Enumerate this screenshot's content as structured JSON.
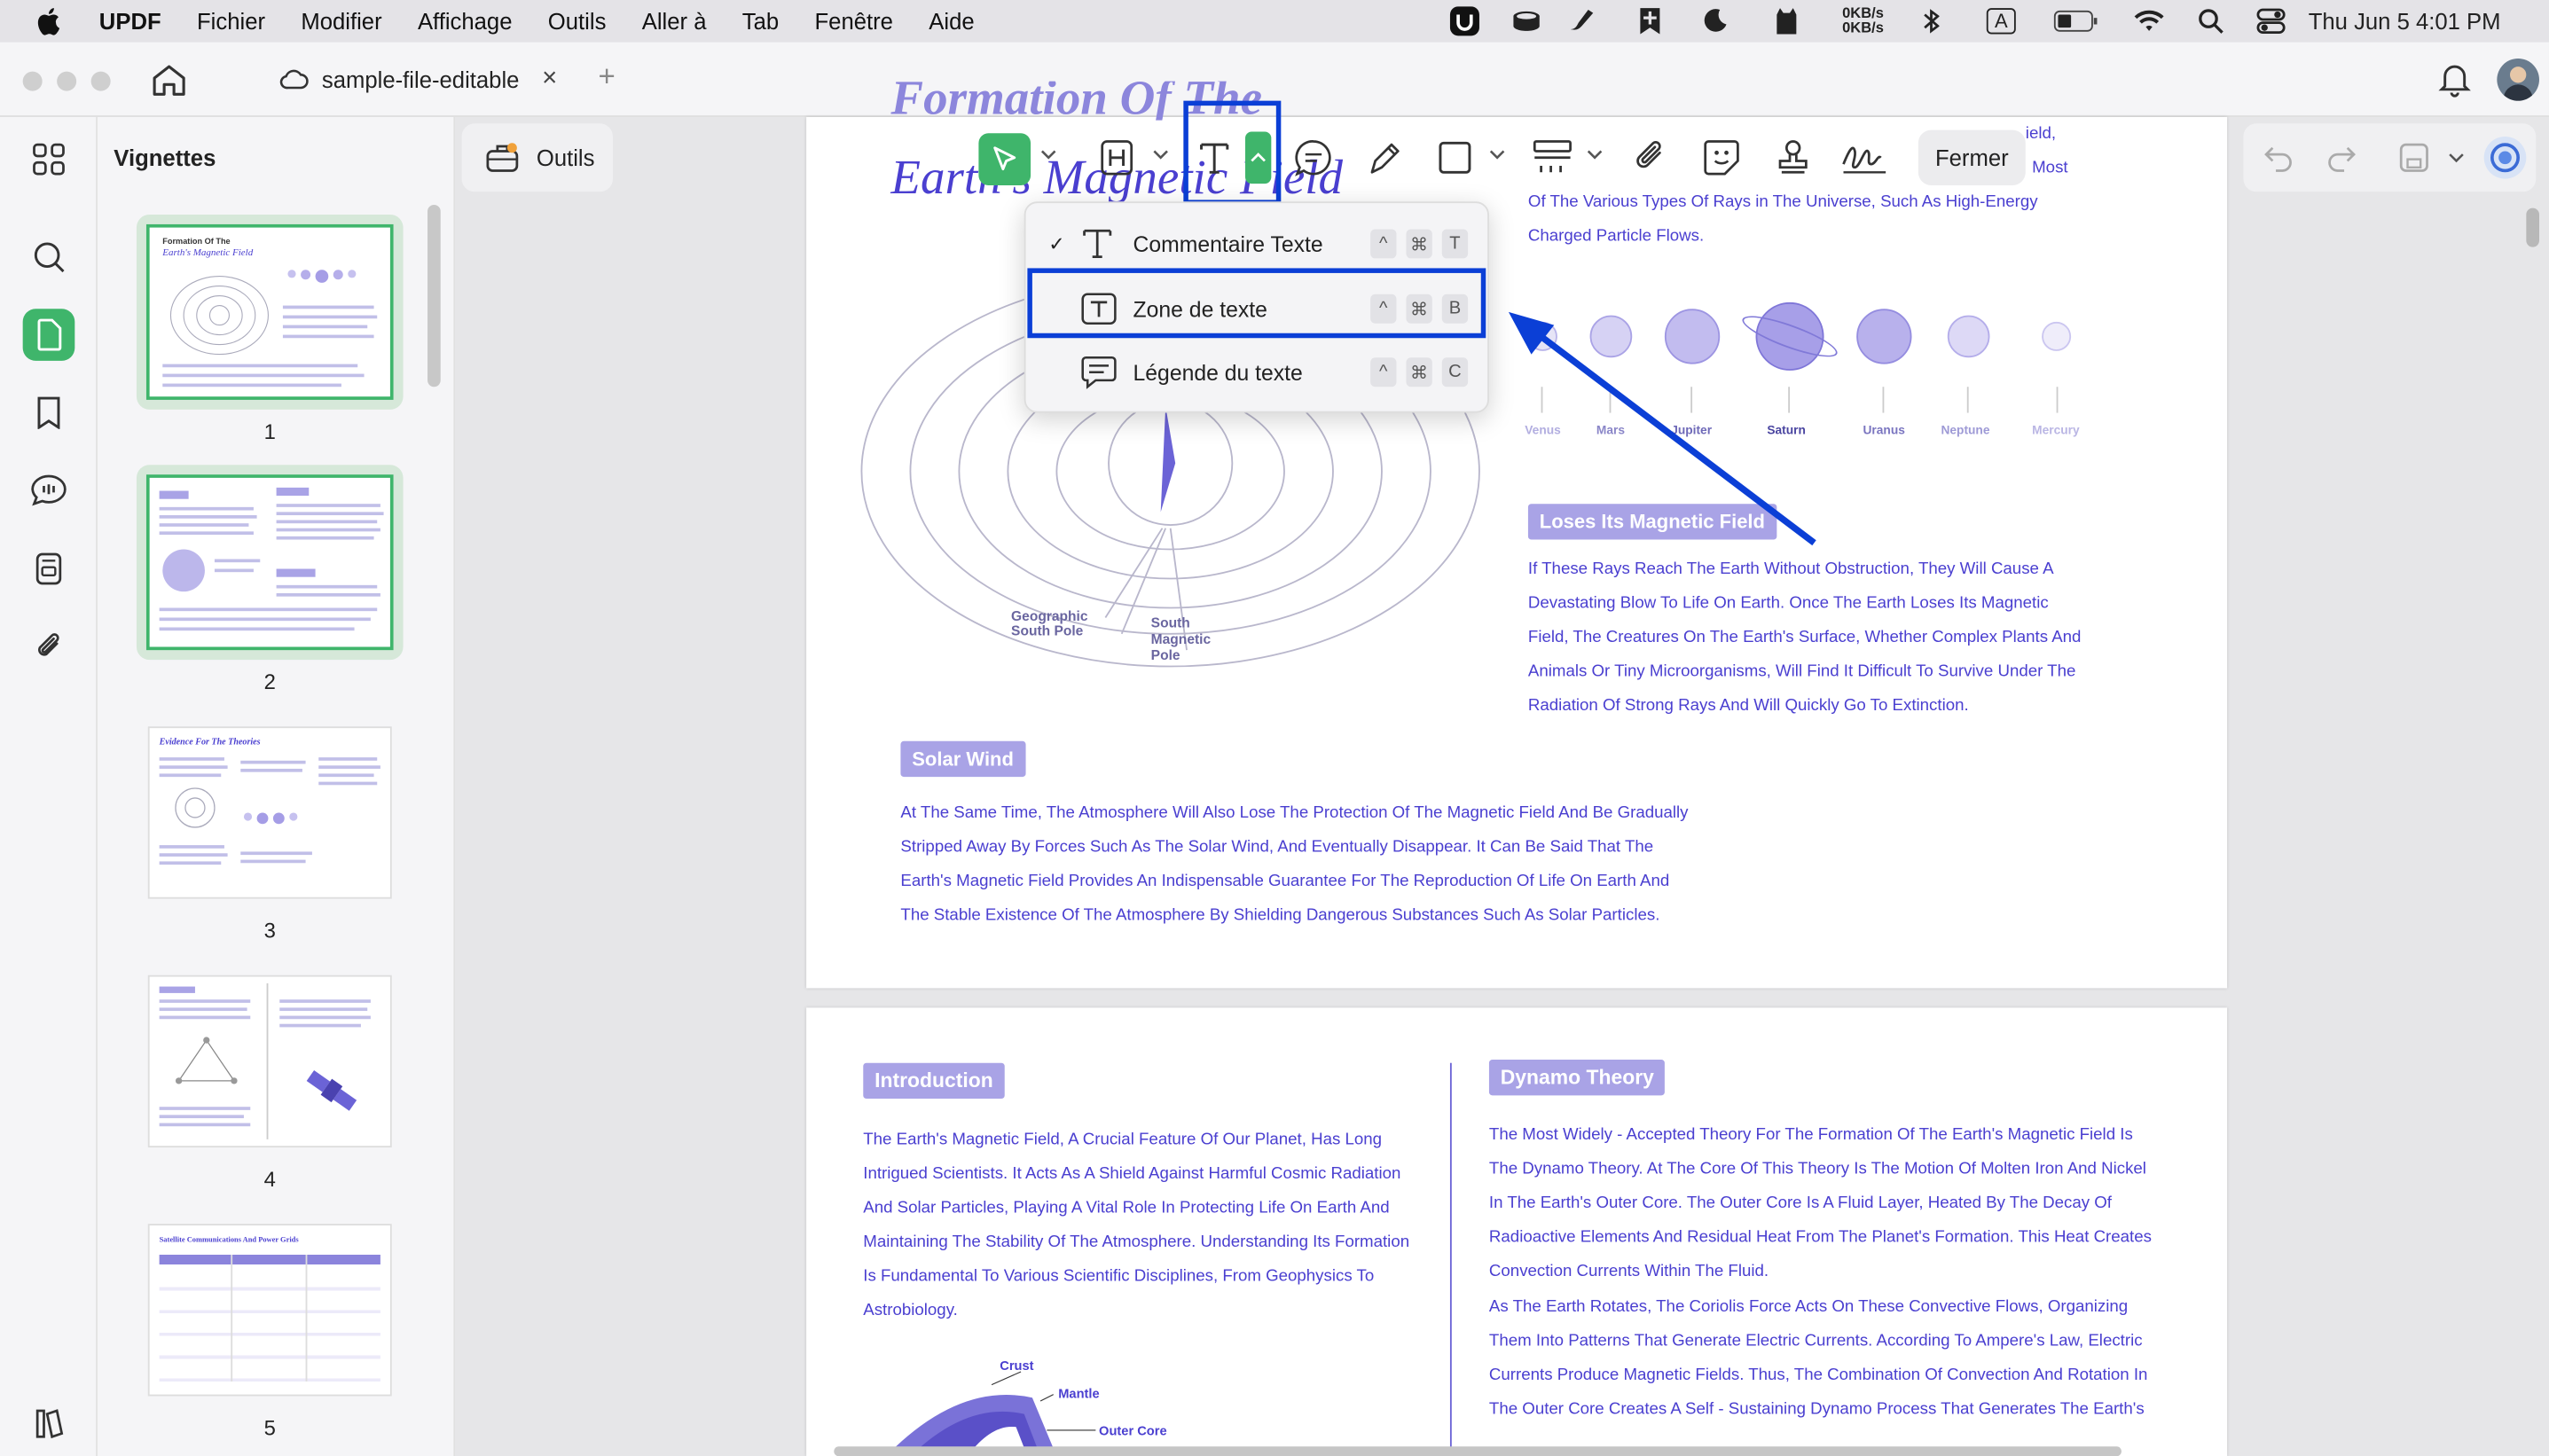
{
  "menubar": {
    "apple_icon": "apple-icon",
    "app": "UPDF",
    "items": [
      "Fichier",
      "Modifier",
      "Affichage",
      "Outils",
      "Aller à",
      "Tab",
      "Fenêtre",
      "Aide"
    ],
    "net_up": "0KB/s",
    "net_down": "0KB/s",
    "input_source": "A",
    "datetime": "Thu Jun 5  4:01 PM"
  },
  "tab": {
    "title": "sample-file-editable",
    "close": "×",
    "new": "+"
  },
  "sidebar": {
    "title": "Vignettes"
  },
  "thumbnails": [
    {
      "page": "1",
      "heading": "Formation Of The",
      "subheading": "Earth's Magnetic Field"
    },
    {
      "page": "2"
    },
    {
      "page": "3",
      "heading": "Evidence For The Theories"
    },
    {
      "page": "4"
    },
    {
      "page": "5",
      "heading": "Satellite Communications And Power Grids"
    }
  ],
  "toolbar": {
    "outils_label": "Outils",
    "fermer_label": "Fermer"
  },
  "dropdown": {
    "items": [
      {
        "check": "✓",
        "label": "Commentaire Texte",
        "keys": [
          "^",
          "⌘",
          "T"
        ]
      },
      {
        "check": "",
        "label": "Zone de texte",
        "keys": [
          "^",
          "⌘",
          "B"
        ]
      },
      {
        "check": "",
        "label": "Légende du texte",
        "keys": [
          "^",
          "⌘",
          "C"
        ]
      }
    ]
  },
  "page1": {
    "title_line1": "Formation Of The",
    "title_line2": "Earth's Magnetic Field",
    "intro_text": [
      "ield,",
      "Most",
      "Of The Various Types Of Rays in The Universe, Such As High-Energy",
      "Charged Particle Flows."
    ],
    "planets": [
      "Venus",
      "Mars",
      "Jupiter",
      "Saturn",
      "Uranus",
      "Neptune",
      "Mercury"
    ],
    "pole_labels": {
      "geo": "Geographic\nSouth Pole",
      "mag": "South\nMagnetic\nPole"
    },
    "loses_heading": "Loses Its Magnetic Field",
    "loses_text": [
      "If These Rays Reach The Earth Without Obstruction, They Will Cause A",
      "Devastating Blow To Life On Earth. Once The Earth Loses Its Magnetic",
      "Field, The Creatures On The Earth's Surface, Whether Complex Plants And",
      "Animals Or Tiny Microorganisms, Will Find It Difficult To Survive Under The",
      "Radiation Of Strong Rays And Will Quickly Go To Extinction."
    ],
    "solar_heading": "Solar Wind",
    "solar_text": [
      "At The Same Time, The Atmosphere Will Also Lose The Protection Of The Magnetic Field And Be Gradually",
      "Stripped Away By Forces Such As The Solar Wind, And Eventually Disappear. It Can Be Said That The",
      "Earth's Magnetic Field Provides An Indispensable Guarantee For The Reproduction Of Life On Earth And",
      "The Stable Existence Of The Atmosphere By Shielding Dangerous Substances Such As Solar Particles."
    ]
  },
  "page2": {
    "intro_heading": "Introduction",
    "intro_text": [
      "The Earth's Magnetic Field, A Crucial Feature Of Our Planet, Has Long",
      "Intrigued Scientists. It Acts As A Shield Against Harmful Cosmic Radiation",
      "And Solar Particles, Playing A Vital Role In Protecting Life On Earth And",
      "Maintaining The Stability Of The Atmosphere. Understanding Its Formation",
      "Is Fundamental To Various Scientific Disciplines, From Geophysics To",
      "Astrobiology."
    ],
    "layers": [
      "Crust",
      "Mantle",
      "Outer Core"
    ],
    "dynamo_heading": "Dynamo Theory",
    "dynamo_text": [
      "The Most Widely - Accepted Theory For The Formation Of The Earth's Magnetic Field Is",
      "The Dynamo Theory. At The Core Of This Theory Is The Motion Of Molten Iron And Nickel",
      "In The Earth's Outer Core. The Outer Core Is A Fluid Layer, Heated By The Decay Of",
      "Radioactive Elements And Residual Heat From The Planet's Formation. This Heat Creates",
      "Convection Currents Within The Fluid.",
      "As The Earth Rotates, The Coriolis Force Acts On These Convective Flows, Organizing",
      "Them Into Patterns That Generate Electric Currents. According To Ampere's Law, Electric",
      "Currents Produce Magnetic Fields. Thus, The Combination Of Convection And Rotation In",
      "The Outer Core Creates A Self - Sustaining Dynamo Process That Generates The Earth's"
    ]
  },
  "colors": {
    "accent_green": "#3fb56b",
    "highlight_blue": "#0b3fd6",
    "text_purple": "#4a3fd0",
    "heading_bg": "#a9a3e6"
  }
}
